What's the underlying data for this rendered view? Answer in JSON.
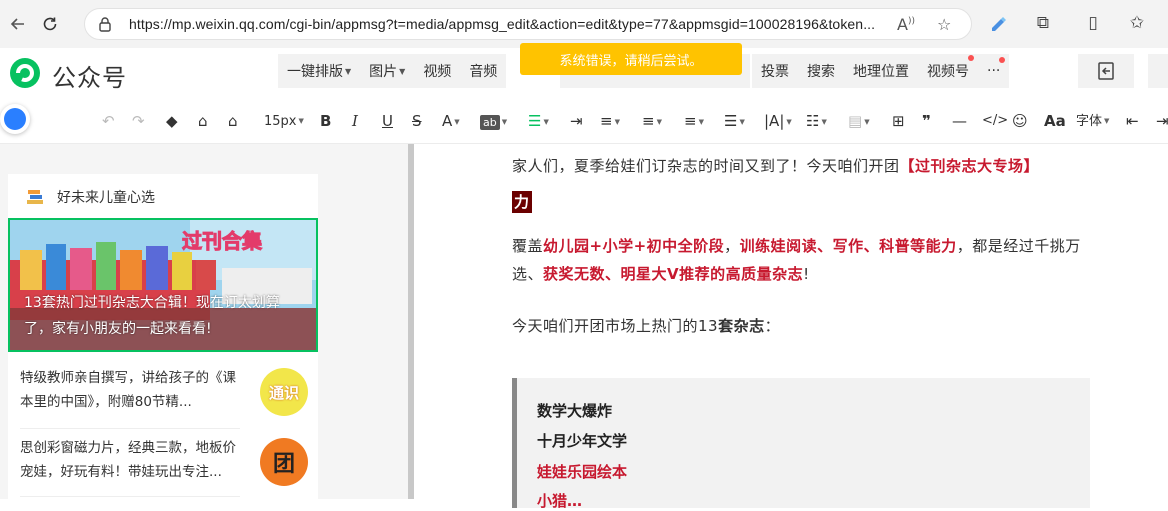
{
  "browser": {
    "url": "https://mp.weixin.qq.com/cgi-bin/appmsg?t=media/appmsg_edit&action=edit&type=77&appmsgid=100028196&token..."
  },
  "header": {
    "brand": "公众号",
    "menu_left": [
      {
        "label": "一键排版",
        "caret": true
      },
      {
        "label": "图片",
        "caret": true
      },
      {
        "label": "视频",
        "caret": false
      },
      {
        "label": "音频",
        "caret": false
      }
    ],
    "menu_right": [
      {
        "label": "投票",
        "dot": false
      },
      {
        "label": "搜索",
        "dot": false
      },
      {
        "label": "地理位置",
        "dot": false
      },
      {
        "label": "视频号",
        "dot": true
      },
      {
        "label": "···",
        "dot": true
      }
    ],
    "toast": "系统错误，请稍后尝试。"
  },
  "toolbar": {
    "font_size": "15px",
    "font_family": "字体"
  },
  "sidebar": {
    "account_name": "好未来儿童心选",
    "cover": {
      "banner_text": "过刊合集",
      "title": "13套热门过刊杂志大合辑！现在订太划算了，家有小朋友的一起来看看!"
    },
    "items": [
      {
        "title": "特级教师亲自撰写，讲给孩子的《课本里的中国》，附赠80节精...",
        "thumb_text": "通识",
        "thumb_color": "#f2e64a"
      },
      {
        "title": "思创彩窗磁力片，经典三款，地板价宠娃，好玩有料！带娃玩出专注...",
        "thumb_text": "团",
        "thumb_color": "#f07a22"
      }
    ]
  },
  "editor": {
    "p1_a": "家人们，夏季给娃们订杂志的时间又到了！今天咱们开团",
    "p1_b": "【过刊杂志大专场】",
    "p1_c": "力",
    "p2_a": "覆盖",
    "p2_b": "幼儿园+小学+初中全阶段",
    "p2_c": "，",
    "p2_d": "训练娃阅读、写作、科普等能力",
    "p2_e": "，都是经过千挑万选、",
    "p2_f": "获奖无数、明星大V推荐的高质量杂志",
    "p2_g": "!",
    "p3_a": "今天咱们开团市场上热门的13",
    "p3_b": "套杂志",
    "p3_c": "：",
    "quote_lines": [
      {
        "text": "数学大爆炸",
        "red": false
      },
      {
        "text": "十月少年文学",
        "red": false
      },
      {
        "text": "娃娃乐园绘本",
        "red": true
      },
      {
        "text": "小猎…",
        "red": true
      }
    ]
  },
  "colors": {
    "accent_green": "#07c160",
    "highlight_red": "#c7192f",
    "toast_yellow": "#ffc300"
  }
}
